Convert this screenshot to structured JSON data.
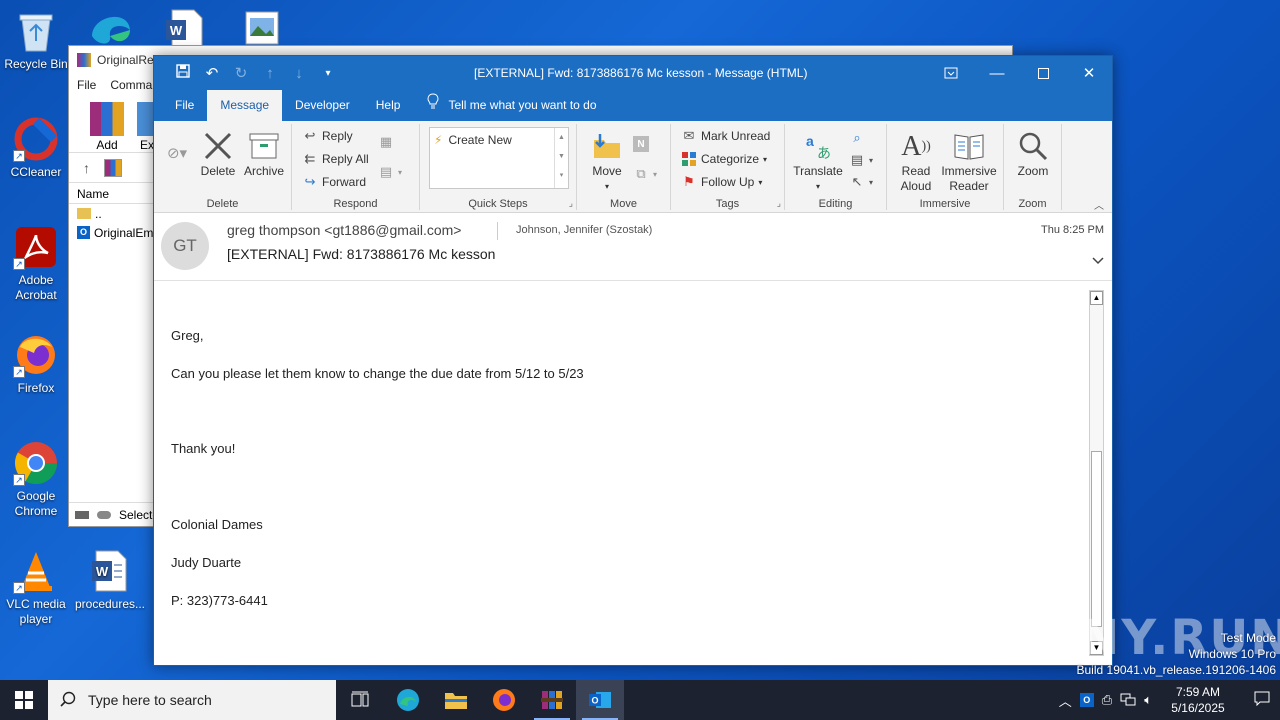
{
  "desktop": {
    "icons": [
      {
        "label": "Recycle Bin",
        "icon": "recycle-bin-icon"
      },
      {
        "label": "CCleaner",
        "icon": "ccleaner-icon"
      },
      {
        "label": "Adobe Acrobat",
        "icon": "acrobat-icon"
      },
      {
        "label": "Firefox",
        "icon": "firefox-icon"
      },
      {
        "label": "Google Chrome",
        "icon": "chrome-icon"
      },
      {
        "label": "VLC media player",
        "icon": "vlc-icon"
      },
      {
        "label": "procedures...",
        "icon": "word-doc-icon"
      }
    ]
  },
  "winrar": {
    "title": "OriginalRe",
    "menu": [
      "File",
      "Comman"
    ],
    "tools": {
      "add": "Add",
      "extract": "Ex"
    },
    "column_name": "Name",
    "rows": [
      "..",
      "OriginalEm"
    ],
    "status": "Selecte"
  },
  "outlook": {
    "caption": "[EXTERNAL] Fwd: 8173886176 Mc kesson  -  Message (HTML)",
    "tabs": [
      "File",
      "Message",
      "Developer",
      "Help"
    ],
    "active_tab": "Message",
    "tell_me": "Tell me what you want to do",
    "ribbon": {
      "delete_group": {
        "label": "Delete",
        "delete": "Delete",
        "archive": "Archive"
      },
      "respond_group": {
        "label": "Respond",
        "reply": "Reply",
        "reply_all": "Reply All",
        "forward": "Forward"
      },
      "quicksteps_group": {
        "label": "Quick Steps",
        "create_new": "Create New"
      },
      "move_group": {
        "label": "Move",
        "move": "Move"
      },
      "tags_group": {
        "label": "Tags",
        "mark_unread": "Mark Unread",
        "categorize": "Categorize",
        "follow_up": "Follow Up"
      },
      "editing_group": {
        "label": "Editing",
        "translate": "Translate"
      },
      "immersive_group": {
        "label": "Immersive",
        "read_aloud_1": "Read",
        "read_aloud_2": "Aloud",
        "immersive_reader_1": "Immersive",
        "immersive_reader_2": "Reader"
      },
      "zoom_group": {
        "label": "Zoom",
        "zoom": "Zoom"
      }
    },
    "message": {
      "avatar_initials": "GT",
      "from": "greg thompson <gt1886@gmail.com>",
      "to": "Johnson, Jennifer (Szostak)",
      "date": "Thu 8:25 PM",
      "subject": "[EXTERNAL] Fwd: 8173886176 Mc kesson",
      "body": {
        "greeting": "Greg,",
        "line1": "Can you please let  them know to change the due date from 5/12 to 5/23",
        "thanks": "Thank you!",
        "sig1": "Colonial Dames",
        "sig2": "Judy Duarte",
        "sig3": "P: 323)773-6441"
      }
    }
  },
  "taskbar": {
    "search_placeholder": "Type here to search",
    "time": "7:59 AM",
    "date": "5/16/2025"
  },
  "watermark": {
    "line1": "Test Mode",
    "line2": "Windows 10 Pro",
    "line3": "Build 19041.vb_release.191206-1406",
    "brand": "ANY.RUN"
  }
}
